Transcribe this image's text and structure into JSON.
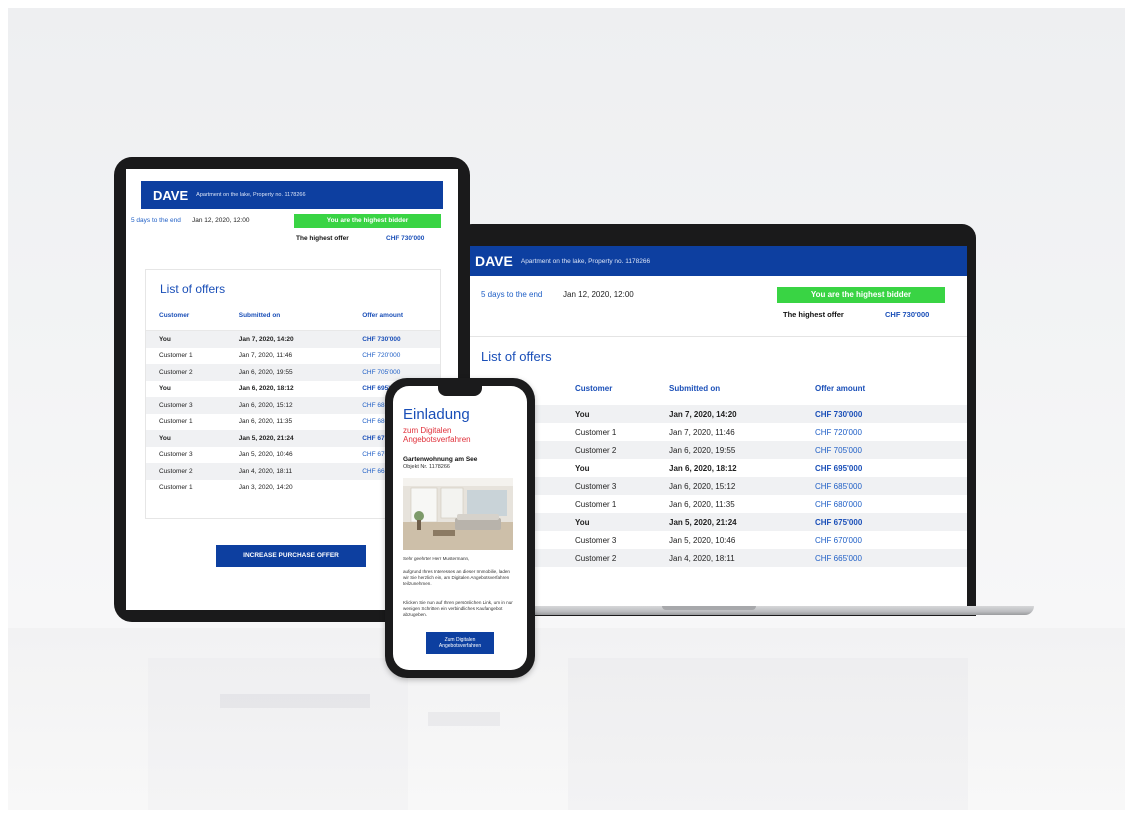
{
  "brand": "DAVE",
  "property": "Apartment on the lake, Property no. 1178266",
  "countdown": "5 days to the end",
  "deadline": "Jan 12, 2020, 12:00",
  "status_banner": "You are the highest bidder",
  "highest_offer_label": "The highest offer",
  "highest_offer_value": "CHF 730'000",
  "list_title": "List of offers",
  "columns": {
    "customer": "Customer",
    "submitted": "Submitted on",
    "amount": "Offer amount"
  },
  "offers": [
    {
      "customer": "You",
      "submitted": "Jan 7, 2020, 14:20",
      "amount": "CHF 730'000",
      "bold": true
    },
    {
      "customer": "Customer 1",
      "submitted": "Jan 7, 2020, 11:46",
      "amount": "CHF 720'000",
      "bold": false
    },
    {
      "customer": "Customer 2",
      "submitted": "Jan 6, 2020, 19:55",
      "amount": "CHF 705'000",
      "bold": false
    },
    {
      "customer": "You",
      "submitted": "Jan 6, 2020, 18:12",
      "amount": "CHF 695'000",
      "bold": true
    },
    {
      "customer": "Customer 3",
      "submitted": "Jan 6, 2020, 15:12",
      "amount": "CHF 685'000",
      "bold": false
    },
    {
      "customer": "Customer 1",
      "submitted": "Jan 6, 2020, 11:35",
      "amount": "CHF 680'000",
      "bold": false
    },
    {
      "customer": "You",
      "submitted": "Jan 5, 2020, 21:24",
      "amount": "CHF 675'000",
      "bold": true
    },
    {
      "customer": "Customer 3",
      "submitted": "Jan 5, 2020, 10:46",
      "amount": "CHF 670'000",
      "bold": false
    },
    {
      "customer": "Customer 2",
      "submitted": "Jan 4, 2020, 18:11",
      "amount": "CHF 665'000",
      "bold": false
    },
    {
      "customer": "Customer 1",
      "submitted": "Jan 3, 2020, 14:20",
      "amount": "",
      "bold": false
    }
  ],
  "increase_button": "INCREASE PURCHASE OFFER",
  "phone": {
    "title": "Einladung",
    "subtitle": "zum Digitalen Angebotsverfahren",
    "object_title": "Gartenwohnung am See",
    "object_no": "Objekt Nr. 1178266",
    "greeting": "Sehr geehrter Herr Mustermann,",
    "body1": "aufgrund Ihres Interesses an dieser Immobilie, laden wir Sie herzlich ein, am Digitalen Angebotsverfahren teilzunehmen.",
    "body2": "Klicken Sie nun auf Ihren persönlichen Link, um in nur wenigen Schritten ein verbindliches Kaufangebot abzugeben.",
    "cta": "Zum Digitalen Angebotsverfahren"
  },
  "colors": {
    "brand_blue": "#0d3fa0",
    "banner_green": "#39d444",
    "link_blue": "#1f5fc6",
    "accent_red": "#e0303a"
  }
}
